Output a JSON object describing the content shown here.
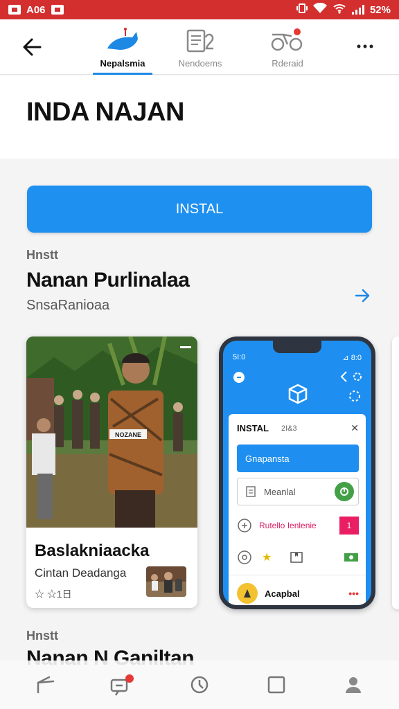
{
  "status_bar": {
    "time": "A06",
    "battery": "52%"
  },
  "top_nav": {
    "tabs": [
      {
        "label": "Nepalsmia",
        "icon": "whale-icon",
        "active": true
      },
      {
        "label": "Nendoems",
        "icon": "document-icon",
        "active": false
      },
      {
        "label": "Rderaid",
        "icon": "bike-icon",
        "active": false
      }
    ]
  },
  "hero": {
    "title": "INDA NAJAN"
  },
  "install_button": {
    "label": "INSTAL"
  },
  "section1": {
    "kicker": "Hnstt",
    "title": "Nanan Purlinalaa",
    "subtitle": "SnsaRanioaa"
  },
  "card": {
    "title": "Baslakniaacka",
    "subtitle": "Cintan Deadanga",
    "meta": "☆ ☆1日",
    "sign_text": "NOZANE"
  },
  "phone": {
    "status_time": "5I:0",
    "status_right": "⊿ 8:0",
    "dialog_title": "INSTAL",
    "dialog_extra": "2I&3",
    "primary_btn": "Gnapansta",
    "input_text": "Meanlal",
    "row3_text": "Rutello Ienlenie",
    "row3_badge": "1",
    "bottom_label": "Acapbal",
    "bottom_dots": "•••"
  },
  "section2": {
    "kicker": "Hnstt",
    "title": "Nanan N Ganiltan"
  },
  "colors": {
    "accent": "#1e90f0",
    "status_bar": "#d32f2f",
    "badge": "#e91e63",
    "green": "#43a047"
  }
}
